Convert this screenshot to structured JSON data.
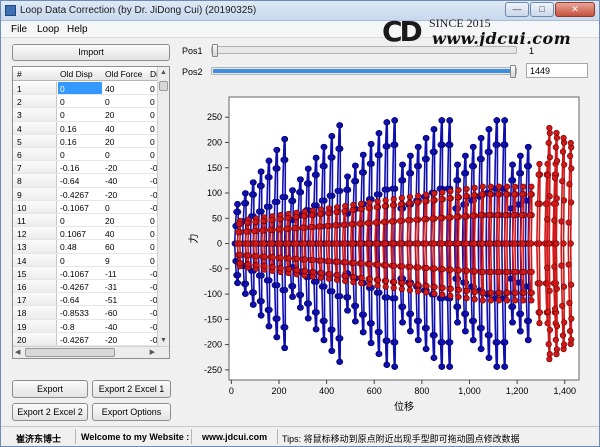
{
  "window": {
    "title": "Loop Data Correction (by Dr. JiDong Cui) (20190325)",
    "minimize": "—",
    "maximize": "□",
    "close": "✕"
  },
  "menu": [
    "File",
    "Loop",
    "Help"
  ],
  "logo": {
    "mark": "CD",
    "since": "SINCE 2015",
    "url": "www.jdcui.com"
  },
  "import_label": "Import",
  "pos1": {
    "label": "Pos1",
    "value": "1"
  },
  "pos2": {
    "label": "Pos2",
    "value": "1449",
    "fill_fraction": 1.0
  },
  "table": {
    "headers": [
      "#",
      "Old Disp",
      "Old Force",
      "Di"
    ],
    "rows": [
      [
        "1",
        "0",
        "40",
        "0"
      ],
      [
        "2",
        "0",
        "0",
        "0"
      ],
      [
        "3",
        "0",
        "20",
        "0"
      ],
      [
        "4",
        "0.16",
        "40",
        "0"
      ],
      [
        "5",
        "0.16",
        "20",
        "0"
      ],
      [
        "6",
        "0",
        "0",
        "0"
      ],
      [
        "7",
        "-0.16",
        "-20",
        "-0"
      ],
      [
        "8",
        "-0.64",
        "-40",
        "-0"
      ],
      [
        "9",
        "-0.4267",
        "-20",
        "-0"
      ],
      [
        "10",
        "-0.1067",
        "0",
        "-0"
      ],
      [
        "11",
        "0",
        "20",
        "0"
      ],
      [
        "12",
        "0.1067",
        "40",
        "0"
      ],
      [
        "13",
        "0.48",
        "60",
        "0"
      ],
      [
        "14",
        "0",
        "9",
        "0"
      ],
      [
        "15",
        "-0.1067",
        "-11",
        "-0"
      ],
      [
        "16",
        "-0.4267",
        "-31",
        "-0"
      ],
      [
        "17",
        "-0.64",
        "-51",
        "-0"
      ],
      [
        "18",
        "-0.8533",
        "-60",
        "-0"
      ],
      [
        "19",
        "-0.8",
        "-40",
        "-0"
      ],
      [
        "20",
        "-0.4267",
        "-20",
        "-0"
      ]
    ]
  },
  "buttons": {
    "export": "Export",
    "export_excel1": "Export 2 Excel 1",
    "export_excel2": "Export 2 Excel 2",
    "export_options": "Export Options"
  },
  "status": {
    "author": "崔济东博士",
    "welcome": "Welcome to my Website :",
    "site": "www.jdcui.com",
    "tips": "Tips: 将鼠标移动到原点附近出现手型即可拖动圆点修改数据"
  },
  "chart_data": {
    "type": "scatter",
    "xlabel": "位移",
    "ylabel": "力",
    "xlim": [
      -10,
      1460
    ],
    "ylim": [
      -270,
      290
    ],
    "xticks": [
      "0",
      "200",
      "400",
      "600",
      "800",
      "1,000",
      "1,200",
      "1,400"
    ],
    "xtick_values": [
      0,
      200,
      400,
      600,
      800,
      1000,
      1200,
      1400
    ],
    "yticks": [
      "250",
      "200",
      "150",
      "100",
      "50",
      "0",
      "-50",
      "-100",
      "-150",
      "-200",
      "-250"
    ],
    "ytick_values": [
      250,
      200,
      150,
      100,
      50,
      0,
      -50,
      -100,
      -150,
      -200,
      -250
    ],
    "series_colors": {
      "old": "#1010b0",
      "new": "#d01818"
    },
    "grid": false
  }
}
